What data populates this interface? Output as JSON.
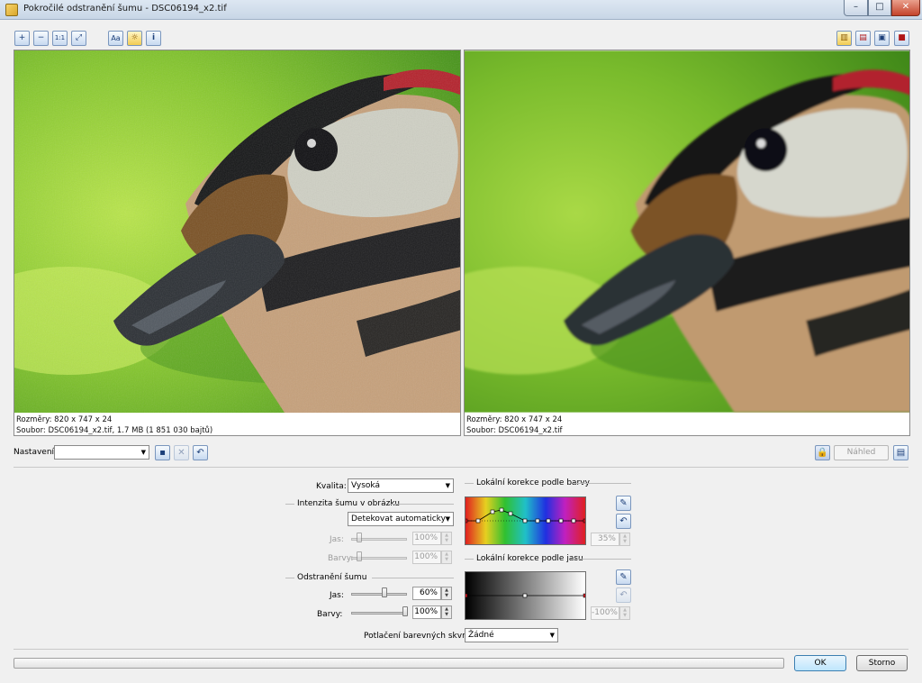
{
  "window": {
    "title": "Pokročilé odstranění šumu - DSC06194_x2.tif",
    "minimize": "–",
    "maximize": "□",
    "close": "✕"
  },
  "toolbar": {
    "left_tools": [
      {
        "name": "zoom-in-icon",
        "glyph": "+"
      },
      {
        "name": "zoom-out-icon",
        "glyph": "−"
      },
      {
        "name": "actual-size-icon",
        "glyph": "1:1"
      },
      {
        "name": "fit-to-window-icon",
        "glyph": "⤢"
      },
      {
        "name": "text-overlay-icon",
        "glyph": "Aa"
      },
      {
        "name": "highlight-icon",
        "glyph": "☼"
      },
      {
        "name": "info-icon",
        "glyph": "i"
      }
    ],
    "right_tools": [
      {
        "name": "split-vertical-icon",
        "glyph": "▥"
      },
      {
        "name": "split-horizontal-icon",
        "glyph": "▤"
      },
      {
        "name": "single-view-icon",
        "glyph": "▣"
      },
      {
        "name": "original-view-icon",
        "glyph": "■"
      }
    ]
  },
  "previews": {
    "left": {
      "dimensions": "Rozměry: 820 x 747 x 24",
      "file": "Soubor: DSC06194_x2.tif, 1.7 MB (1 851 030 bajtů)"
    },
    "right": {
      "dimensions": "Rozměry: 820 x 747 x 24",
      "file": "Soubor: DSC06194_x2.tif"
    }
  },
  "settings": {
    "label": "Nastavení:",
    "value": "",
    "preview_button": "Náhled"
  },
  "controls": {
    "quality_label": "Kvalita:",
    "quality_value": "Vysoká",
    "noise_intensity_header": "Intenzita šumu v obrázku",
    "noise_mode_value": "Detekovat automaticky",
    "intensity_brightness_label": "Jas:",
    "intensity_brightness_value": "100%",
    "intensity_brightness_level": 0.1,
    "intensity_color_label": "Barvy:",
    "intensity_color_value": "100%",
    "intensity_color_level": 0.1,
    "removal_header": "Odstranění šumu",
    "removal_brightness_label": "Jas:",
    "removal_brightness_value": "60%",
    "removal_brightness_level": 0.6,
    "removal_color_label": "Barvy:",
    "removal_color_value": "100%",
    "removal_color_level": 1.0,
    "spot_label": "Potlačení barevných skvrn:",
    "spot_value": "Žádné"
  },
  "local_color": {
    "header": "Lokální korekce podle barvy",
    "strength_value": "35%"
  },
  "local_brightness": {
    "header": "Lokální korekce podle jasu",
    "strength_value": "-100%"
  },
  "footer": {
    "progress": 0,
    "ok": "OK",
    "cancel": "Storno"
  }
}
